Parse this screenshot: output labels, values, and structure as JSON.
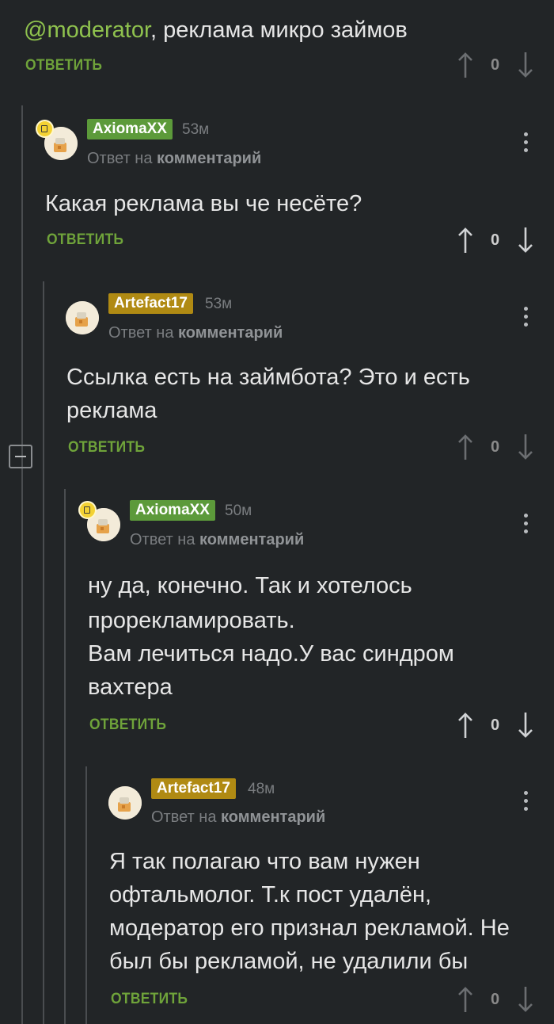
{
  "top": {
    "mention": "@moderator",
    "text": ", реклама микро займов",
    "reply": "ОТВЕТИТЬ",
    "votes": "0"
  },
  "comments": [
    {
      "nick": "AxiomaXX",
      "time": "53м",
      "reply_to_prefix": "Ответ на",
      "reply_to_link": "комментарий",
      "lines": [
        "Какая реклама вы че несёте?"
      ],
      "reply": "ОТВЕТИТЬ",
      "votes": "0"
    },
    {
      "nick": "Artefact17",
      "time": "53м",
      "reply_to_prefix": "Ответ на",
      "reply_to_link": "комментарий",
      "lines": [
        "Ссылка есть на займбота? Это и есть",
        "реклама"
      ],
      "reply": "ОТВЕТИТЬ",
      "votes": "0"
    },
    {
      "nick": "AxiomaXX",
      "time": "50м",
      "reply_to_prefix": "Ответ на",
      "reply_to_link": "комментарий",
      "lines": [
        "ну да, конечно. Так и хотелось",
        "прорекламировать.",
        "Вам лечиться надо.У вас синдром",
        "вахтера"
      ],
      "reply": "ОТВЕТИТЬ",
      "votes": "0"
    },
    {
      "nick": "Artefact17",
      "time": "48м",
      "reply_to_prefix": "Ответ на",
      "reply_to_link": "комментарий",
      "lines": [
        "Я так полагаю что вам нужен",
        "офтальмолог. Т.к пост удалён,",
        "модератор его признал рекламой. Не",
        "был бы рекламой, не удалили бы"
      ],
      "reply": "ОТВЕТИТЬ",
      "votes": "0"
    }
  ],
  "colors": {
    "background": "#222527",
    "accent_green": "#6fa33a",
    "nick_green": "#5c9a3a",
    "nick_gold": "#b08a13"
  },
  "icons": [
    "arrow-up-icon",
    "arrow-down-icon",
    "more-vertical-icon",
    "collapse-icon",
    "user-avatar-icon",
    "badge-icon"
  ]
}
